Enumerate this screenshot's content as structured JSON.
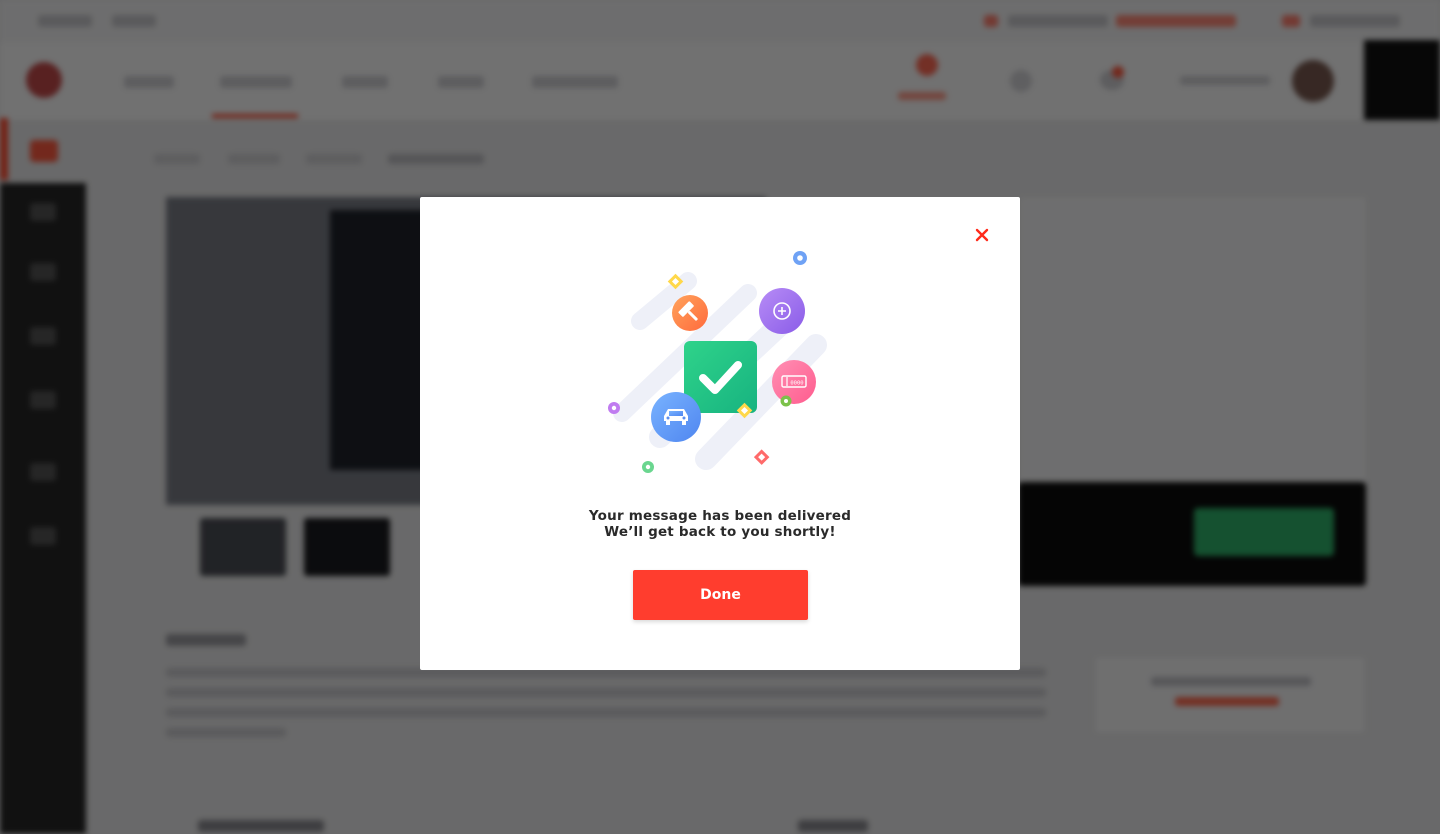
{
  "modal": {
    "message_line1": "Your message has been delivered",
    "message_line2": "We’ll get back to you shortly!",
    "done_label": "Done",
    "close_glyph": "×"
  },
  "colors": {
    "accent": "#ff3d2e",
    "overlay": "rgba(0,0,0,0.55)",
    "success_green": "#2fc07a"
  },
  "illustration_icons": [
    "gavel-icon",
    "plus-icon",
    "checkmark-icon",
    "car-icon",
    "ticket-icon"
  ]
}
